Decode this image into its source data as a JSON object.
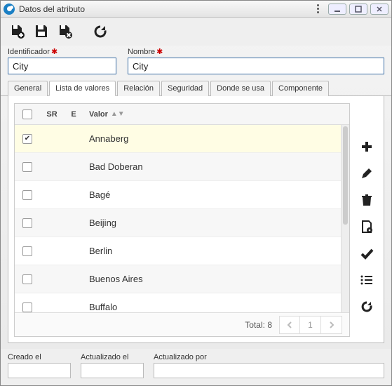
{
  "window": {
    "title": "Datos del atributo"
  },
  "toolbar": {
    "icons": {
      "new": "file-new-icon",
      "save": "save-icon",
      "delete": "file-delete-icon",
      "reload": "reload-icon"
    }
  },
  "fields": {
    "identifier": {
      "label": "Identificador",
      "required": true,
      "value": "City"
    },
    "name": {
      "label": "Nombre",
      "required": true,
      "value": "City"
    }
  },
  "tabs": [
    "General",
    "Lista de valores",
    "Relación",
    "Seguridad",
    "Donde se usa",
    "Componente"
  ],
  "active_tab": 1,
  "grid": {
    "columns": {
      "sr": "SR",
      "e": "E",
      "value": "Valor"
    },
    "rows": [
      {
        "checked": true,
        "sr": "",
        "e": "",
        "value": "Annaberg"
      },
      {
        "checked": false,
        "sr": "",
        "e": "",
        "value": "Bad Doberan"
      },
      {
        "checked": false,
        "sr": "",
        "e": "",
        "value": "Bagé"
      },
      {
        "checked": false,
        "sr": "",
        "e": "",
        "value": "Beijing"
      },
      {
        "checked": false,
        "sr": "",
        "e": "",
        "value": "Berlin"
      },
      {
        "checked": false,
        "sr": "",
        "e": "",
        "value": "Buenos Aires"
      },
      {
        "checked": false,
        "sr": "",
        "e": "",
        "value": "Buffalo"
      }
    ],
    "total_label": "Total:",
    "total_count": 8,
    "page": 1
  },
  "sidetools": [
    "add",
    "edit",
    "trash",
    "settings",
    "check",
    "list",
    "reload"
  ],
  "footer": {
    "created": {
      "label": "Creado el",
      "value": ""
    },
    "updated": {
      "label": "Actualizado el",
      "value": ""
    },
    "updated_by": {
      "label": "Actualizado por",
      "value": ""
    }
  }
}
